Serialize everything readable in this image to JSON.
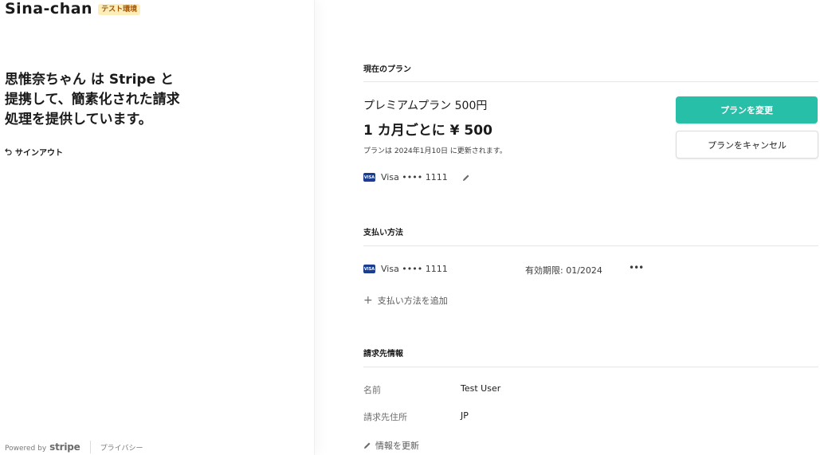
{
  "brand": {
    "name": "Sina-chan",
    "badge": "テスト環境"
  },
  "left": {
    "headline": "思惟奈ちゃん は Stripe と提携して、簡素化された請求処理を提供しています。",
    "signout_label": "サインアウト"
  },
  "footer": {
    "powered_by": "Powered by",
    "stripe": "stripe",
    "privacy": "プライバシー"
  },
  "current_plan": {
    "section_title": "現在のプラン",
    "plan_name": "プレミアムプラン 500円",
    "price": "1 カ月ごとに ¥ 500",
    "renewal": "プランは 2024年1月10日 に更新されます。",
    "card": {
      "brand": "VISA",
      "label": "Visa •••• 1111"
    },
    "change_button": "プランを変更",
    "cancel_button": "プランをキャンセル"
  },
  "payment_methods": {
    "section_title": "支払い方法",
    "items": [
      {
        "brand": "VISA",
        "label": "Visa •••• 1111",
        "expiry": "有効期限: 01/2024",
        "more": "•••"
      }
    ],
    "add_label": "支払い方法を追加"
  },
  "billing_info": {
    "section_title": "請求先情報",
    "rows": [
      {
        "label": "名前",
        "value": "Test User"
      },
      {
        "label": "請求先住所",
        "value": "JP"
      }
    ],
    "update_label": "情報を更新"
  },
  "colors": {
    "accent": "#27bfa7",
    "test_badge_bg": "#fcedb9",
    "test_badge_text": "#a35200",
    "visa_blue": "#1a3d8f"
  }
}
